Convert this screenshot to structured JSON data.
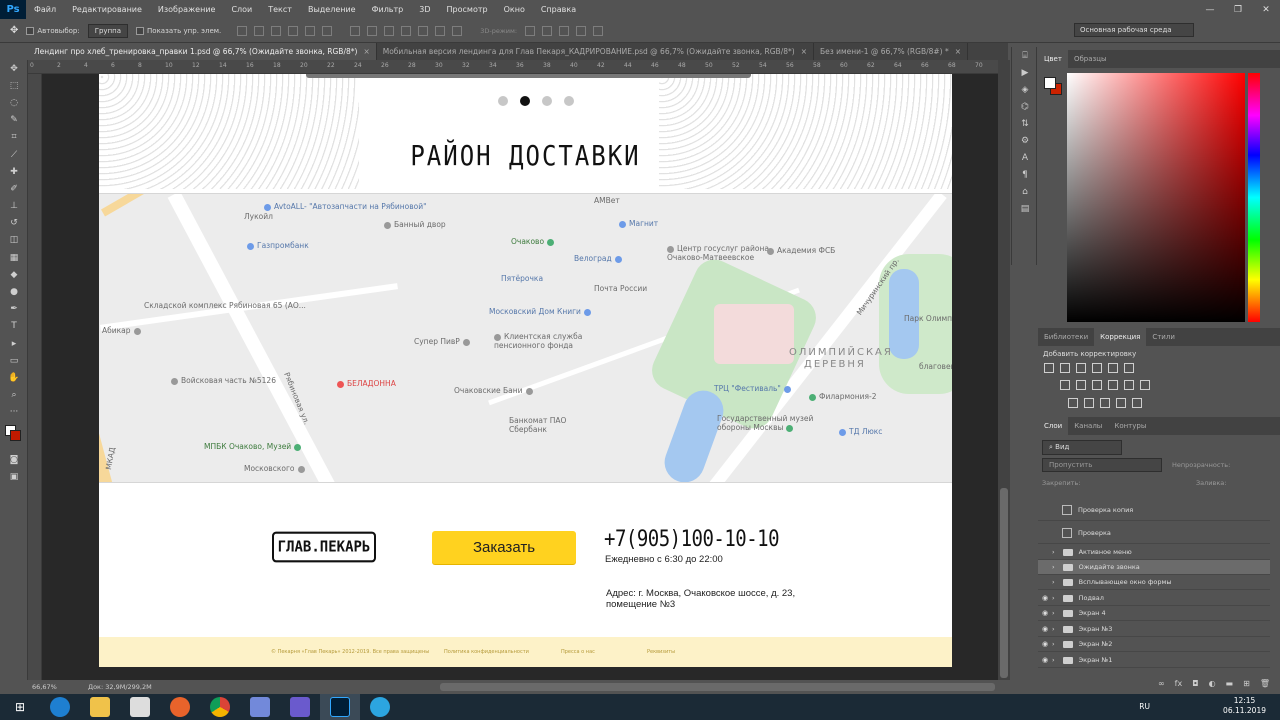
{
  "menubar": {
    "logo": "Ps",
    "items": [
      "Файл",
      "Редактирование",
      "Изображение",
      "Слои",
      "Текст",
      "Выделение",
      "Фильтр",
      "3D",
      "Просмотр",
      "Окно",
      "Справка"
    ]
  },
  "optionsbar": {
    "autoselect_label": "Автовыбор:",
    "autoselect_value": "Группа",
    "show_controls_label": "Показать упр. элем.",
    "mode_3d_label": "3D-режим:",
    "workspace": "Основная рабочая среда"
  },
  "tabs": [
    {
      "label": "Лендинг про хлеб_тренировка_правки 1.psd @ 66,7% (Ожидайте звонка, RGB/8*)",
      "close": "×"
    },
    {
      "label": "Мобильная версия лендинга для Глав Пекаря_КАДРИРОВАНИЕ.psd @ 66,7% (Ожидайте звонка, RGB/8*)",
      "close": "×"
    },
    {
      "label": "Без имени-1 @ 66,7% (RGB/8#) *",
      "close": "×"
    }
  ],
  "ruler_ticks": [
    "0",
    "2",
    "4",
    "6",
    "8",
    "10",
    "12",
    "14",
    "16",
    "18",
    "20",
    "22",
    "24",
    "26",
    "28",
    "30",
    "32",
    "34",
    "36",
    "38",
    "40",
    "42",
    "44",
    "46",
    "48",
    "50",
    "52",
    "54",
    "56",
    "58",
    "60",
    "62",
    "64",
    "66",
    "68",
    "70"
  ],
  "document": {
    "heading": "РАЙОН ДОСТАВКИ",
    "slider_active_index": 1,
    "map": {
      "labels": [
        "AvtoALL- \"Автозапчасти на Рябиновой\"",
        "Банный двор",
        "Лукойл",
        "Газпромбанк",
        "АМВет",
        "Магнит",
        "Очаково",
        "Центр госуслуг района Очаково-Матвеевское",
        "Академия ФСБ",
        "Велоград",
        "Пятёрочка",
        "Почта России",
        "Складской комплекс Рябиновая 65 (АО...",
        "Абикар",
        "Московский Дом Книги",
        "Супер ПивР",
        "Клиентская служба пенсионного фонда",
        "Парк Олимп...",
        "Войсковая часть №5126",
        "БЕЛАДОННА",
        "Очаковские Бани",
        "ОЛИМПИЙСКАЯ",
        "ДЕРЕВНЯ",
        "ТРЦ \"Фестиваль\"",
        "Филармония-2",
        "Банкомат ПАО Сбербанк",
        "Государственный музей обороны Москвы",
        "ТД Люкс",
        "МПБК Очаково, Музей",
        "Московского",
        "МКАД",
        "Рябиновая ул.",
        "Мичуринский пр.",
        "благовещ"
      ]
    },
    "brand": "ГЛАВ.ПЕКАРЬ",
    "order_button": "Заказать",
    "phone": "+7(905)100-10-10",
    "hours": "Ежедневно с 6:30 до 22:00",
    "address": "Адрес: г. Москва, Очаковское шоссе, д. 23, помещение №3",
    "footer": [
      "© Пекарня «Глав Пекарь» 2012-2019. Все права защищены",
      "Политика конфиденциальности",
      "Пресса о нас",
      "Реквизиты"
    ]
  },
  "statusbar": {
    "zoom": "66,67%",
    "doc": "Док: 32,9M/299,2M"
  },
  "rightpanel": {
    "color_tabs": [
      "Цвет",
      "Образцы"
    ],
    "adjust_tabs": [
      "Библиотеки",
      "Коррекция",
      "Стили"
    ],
    "adjust_title": "Добавить корректировку",
    "layer_tabs": [
      "Слои",
      "Каналы",
      "Контуры"
    ],
    "layer_filter": "Вид",
    "blend_mode": "Пропустить",
    "opacity_label": "Непрозрачность:",
    "lock_label": "Закрепить:",
    "fill_label": "Заливка:",
    "layers": [
      {
        "name": "Проверка копия",
        "type": "smart",
        "visible": false
      },
      {
        "name": "Проверка",
        "type": "smart",
        "visible": false
      },
      {
        "name": "Активное меню",
        "type": "folder",
        "visible": false
      },
      {
        "name": "Ожидайте звонка",
        "type": "folder",
        "visible": false,
        "selected": true
      },
      {
        "name": "Всплывающее окно формы",
        "type": "folder",
        "visible": false
      },
      {
        "name": "Подвал",
        "type": "folder",
        "visible": true
      },
      {
        "name": "Экран 4",
        "type": "folder",
        "visible": true
      },
      {
        "name": "Экран №3",
        "type": "folder",
        "visible": true
      },
      {
        "name": "Экран №2",
        "type": "folder",
        "visible": true
      },
      {
        "name": "Экран №1",
        "type": "folder",
        "visible": true
      }
    ]
  },
  "taskbar": {
    "lang": "RU",
    "time": "12:15",
    "date": "06.11.2019"
  },
  "colors": {
    "accent_yellow": "#ffd21f",
    "footer_bg": "#fdf2c8",
    "ps_blue": "#31a8ff",
    "selected_layer": "#6b6b6b"
  }
}
